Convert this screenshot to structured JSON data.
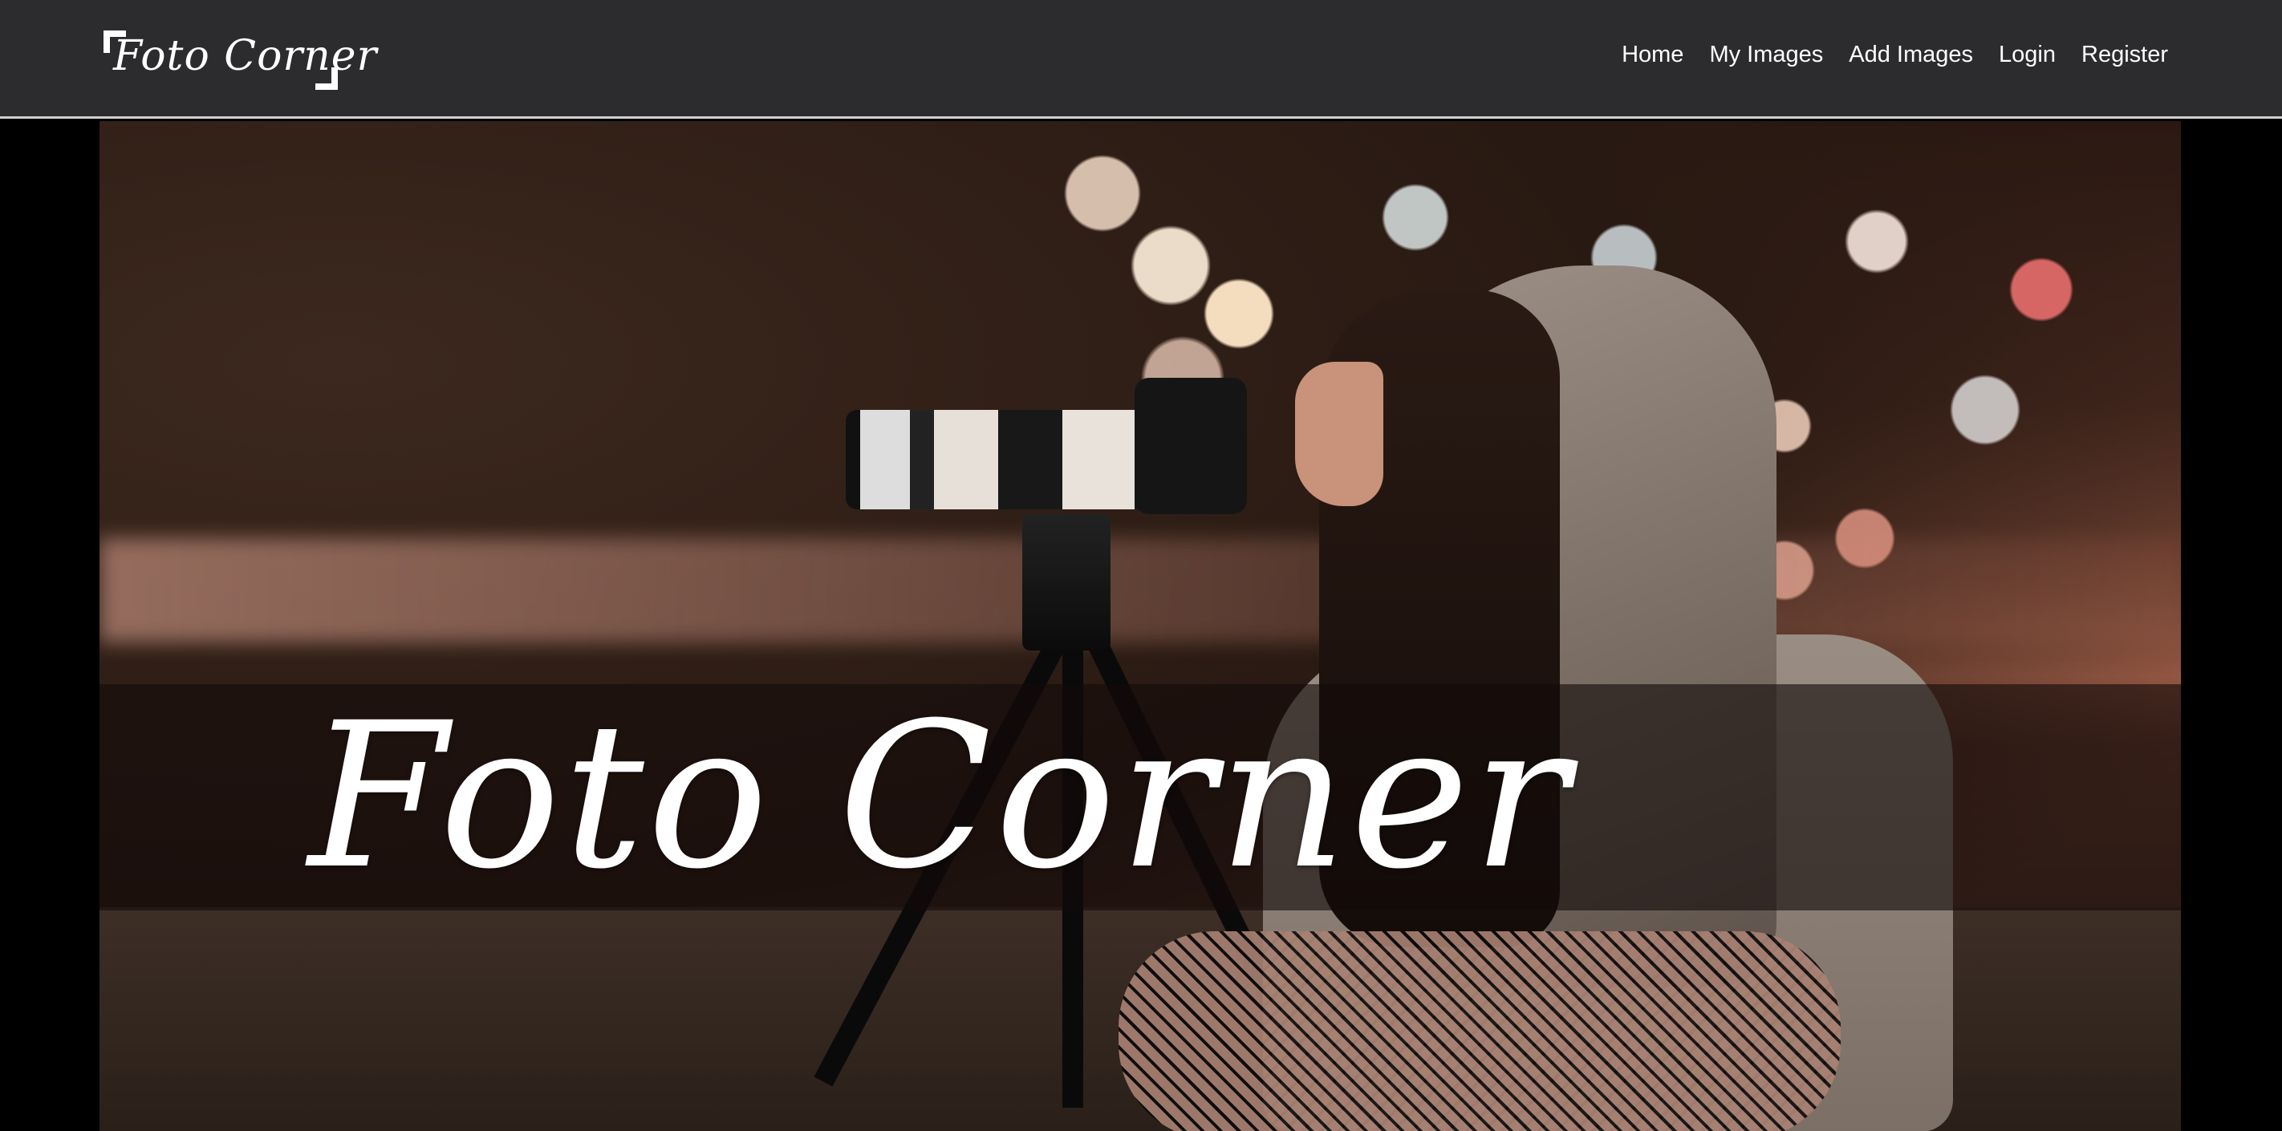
{
  "app": {
    "brand": "Foto Corner"
  },
  "nav": {
    "links": [
      "Home",
      "My Images",
      "Add Images",
      "Login",
      "Register"
    ]
  },
  "hero": {
    "title": "Foto Corner",
    "image": "photographer-with-camera-on-tripod"
  },
  "colors": {
    "navbar_bg": "#2c2c2e",
    "nav_text": "#ffffff",
    "page_bg": "#000000"
  }
}
